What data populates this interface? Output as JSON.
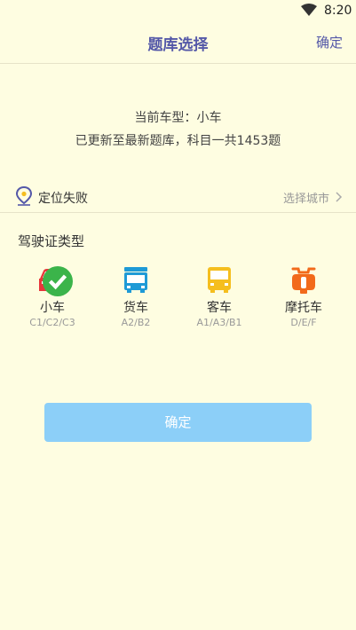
{
  "status_bar": {
    "time": "8:20",
    "icons": [
      "wifi-icon"
    ]
  },
  "header": {
    "title": "题库选择",
    "confirm_label": "确定"
  },
  "info": {
    "current_type": "当前车型：小车",
    "update_message": "已更新至最新题库，科目一共1453题"
  },
  "location": {
    "icon": "location-pin-icon",
    "status": "定位失败",
    "city_link": "选择城市"
  },
  "license_section": {
    "title": "驾驶证类型",
    "vehicles": [
      {
        "name": "小车",
        "codes": "C1/C2/C3",
        "icon": "car-icon",
        "color": "#E8363A",
        "selected": true
      },
      {
        "name": "货车",
        "codes": "A2/B2",
        "icon": "truck-icon",
        "color": "#1E9AD6",
        "selected": false
      },
      {
        "name": "客车",
        "codes": "A1/A3/B1",
        "icon": "bus-icon",
        "color": "#F5BE1E",
        "selected": false
      },
      {
        "name": "摩托车",
        "codes": "D/E/F",
        "icon": "motorcycle-icon",
        "color": "#F26A1B",
        "selected": false
      }
    ]
  },
  "colors": {
    "accent": "#5458A8",
    "background": "#FEFDE1",
    "button": "#8CCFF8",
    "selected_check": "#3BB44A"
  },
  "confirm_button": {
    "label": "确定"
  }
}
